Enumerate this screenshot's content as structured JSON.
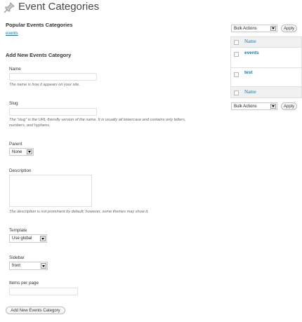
{
  "page": {
    "title": "Event Categories"
  },
  "popular": {
    "heading": "Popular Events Categories",
    "link": "events"
  },
  "form": {
    "heading": "Add New Events Category",
    "name_label": "Name",
    "name_value": "",
    "name_help": "The name is how it appears on your site.",
    "slug_label": "Slug",
    "slug_value": "",
    "slug_help_1": "The “slug” is the URL-friendly version of the name. It is usually all lowercase and contains only letters,",
    "slug_help_2": "numbers, and hyphens.",
    "parent_label": "Parent",
    "parent_value": "None",
    "description_label": "Description",
    "description_value": "",
    "description_help": "The description is not prominent by default; however, some themes may show it.",
    "template_label": "Template",
    "template_value": "Use global",
    "sidebar_label": "Sidebar",
    "sidebar_value": "front",
    "items_label": "Items per page",
    "items_value": "",
    "submit_label": "Add New Events Category"
  },
  "list": {
    "bulk_actions_top": "Bulk Actions",
    "apply_top": "Apply",
    "bulk_actions_bottom": "Bulk Actions",
    "apply_bottom": "Apply",
    "column_header": "Name",
    "column_footer": "Name",
    "rows": [
      {
        "name": "events"
      },
      {
        "name": "test"
      }
    ]
  }
}
